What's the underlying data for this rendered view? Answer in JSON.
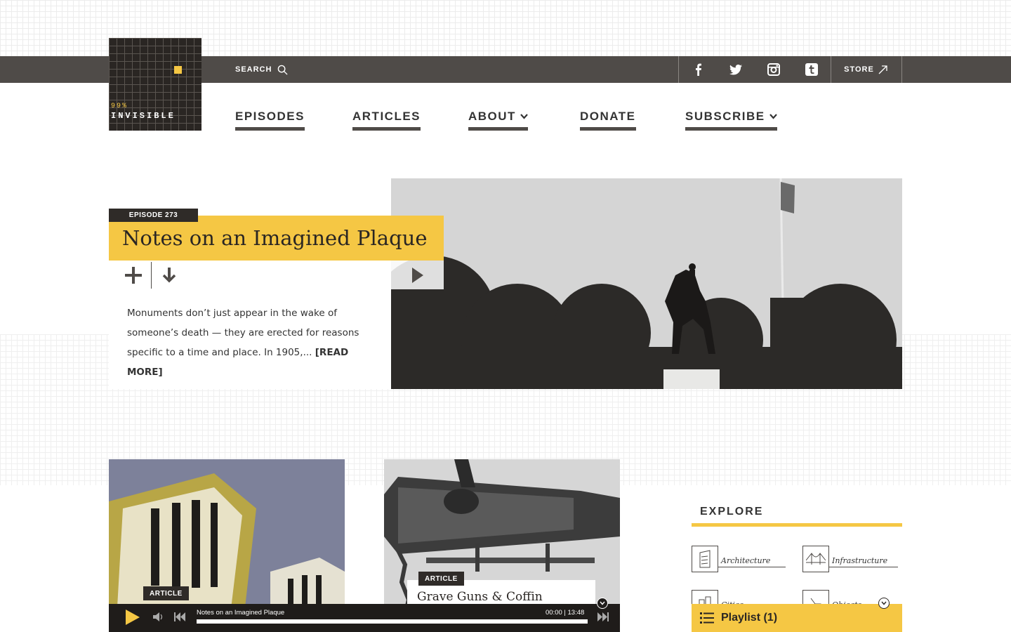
{
  "header": {
    "logo": {
      "percent": "99%",
      "name": "INVISIBLE"
    },
    "search_label": "SEARCH",
    "store_label": "STORE",
    "social": [
      "facebook-icon",
      "twitter-icon",
      "instagram-icon",
      "tumblr-icon"
    ]
  },
  "nav": {
    "items": [
      {
        "label": "EPISODES"
      },
      {
        "label": "ARTICLES"
      },
      {
        "label": "ABOUT"
      },
      {
        "label": "DONATE"
      },
      {
        "label": "SUBSCRIBE"
      }
    ]
  },
  "hero": {
    "episode_tag": "EPISODE 273",
    "title": "Notes on an Imagined Plaque",
    "excerpt": "Monuments don’t just appear in the wake of someone’s death — they are erected for reasons specific to a time and place. In 1905,...",
    "read_more": "[READ MORE]"
  },
  "cards": [
    {
      "tag": "ARTICLE",
      "title": ""
    },
    {
      "tag": "ARTICLE",
      "title": "Grave Guns & Coffin"
    }
  ],
  "player": {
    "track": "Notes on an Imagined Plaque",
    "time": "00:00 | 13:48"
  },
  "explore": {
    "heading": "EXPLORE",
    "categories": [
      {
        "label": "Architecture"
      },
      {
        "label": "Infrastructure"
      },
      {
        "label": "Cities"
      },
      {
        "label": "Objects"
      }
    ]
  },
  "playlist": {
    "label": "Playlist (1)"
  },
  "colors": {
    "accent": "#f5c744",
    "bar": "#4f4b48",
    "dark": "#2a2623"
  }
}
